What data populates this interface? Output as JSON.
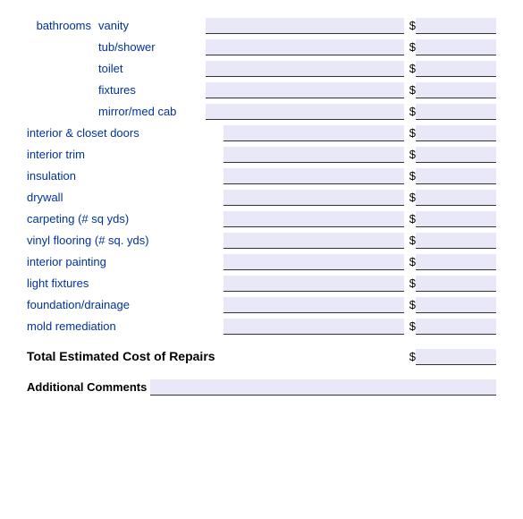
{
  "rows": {
    "bathrooms_label": "bathrooms",
    "sub_items": [
      {
        "label": "vanity"
      },
      {
        "label": "tub/shower"
      },
      {
        "label": "toilet"
      },
      {
        "label": "fixtures"
      },
      {
        "label": "mirror/med cab"
      }
    ],
    "main_items": [
      {
        "label": "interior & closet doors"
      },
      {
        "label": "interior trim"
      },
      {
        "label": "insulation"
      },
      {
        "label": "drywall"
      },
      {
        "label": "carpeting (# sq yds)"
      },
      {
        "label": "vinyl flooring (# sq. yds)"
      },
      {
        "label": "interior painting"
      },
      {
        "label": "light fixtures"
      },
      {
        "label": "foundation/drainage"
      },
      {
        "label": "mold remediation"
      }
    ],
    "total_label": "Total Estimated Cost of Repairs",
    "comments_label": "Additional Comments",
    "dollar_symbol": "$"
  }
}
